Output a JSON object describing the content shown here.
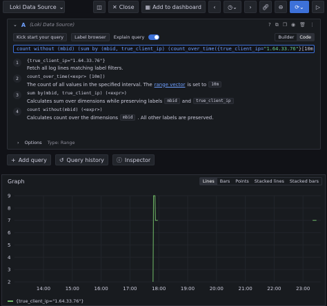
{
  "toolbar": {
    "datasource": "Loki Data Source",
    "close": "Close",
    "add_to_dashboard": "Add to dashboard"
  },
  "query": {
    "letter": "A",
    "datasource_label": "(Loki Data Source)",
    "kick_start": "Kick start your query",
    "label_browser": "Label browser",
    "explain_label": "Explain query",
    "builder": "Builder",
    "code": "Code",
    "expr_parts": {
      "p1": "count without (mbid) (sum by (mbid, true_client_ip) (count_over_time({true_client_ip=",
      "p2": "\"1.64.33.76\"",
      "p3": "}[10m])))"
    }
  },
  "explain": {
    "s1_code": "{true_client_ip=\"1.64.33.76\"}",
    "s1_desc": "Fetch all log lines matching label filters.",
    "s2_code": "count_over_time(<expr> [10m])",
    "s2_desc_a": "The count of all values in the specified interval. The",
    "s2_link": "range vector",
    "s2_desc_b": "is set to",
    "s2_chip": "10m",
    "s3_code": "sum by(mbid, true_client_ip) (<expr>)",
    "s3_desc_a": "Calculates sum over dimensions while preserving labels",
    "s3_chip1": "mbid",
    "s3_and": "and",
    "s3_chip2": "true_client_ip",
    "s4_code": "count without(mbid) (<expr>)",
    "s4_desc_a": "Calculates count over the dimensions",
    "s4_chip": "mbid",
    "s4_desc_b": ". All other labels are preserved."
  },
  "options": {
    "label": "Options",
    "type": "Type: Range"
  },
  "actions": {
    "add_query": "Add query",
    "query_history": "Query history",
    "inspector": "Inspector"
  },
  "graph": {
    "title": "Graph",
    "tabs": [
      "Lines",
      "Bars",
      "Points",
      "Stacked lines",
      "Stacked bars"
    ],
    "legend": "{true_client_ip=\"1.64.33.76\"}"
  },
  "chart_data": {
    "type": "line",
    "title": "Graph",
    "x_ticks": [
      "14:00",
      "15:00",
      "16:00",
      "17:00",
      "18:00",
      "19:00",
      "20:00",
      "21:00",
      "22:00",
      "23:00"
    ],
    "y_ticks": [
      2,
      3,
      4,
      5,
      6,
      7,
      8,
      9
    ],
    "ylim": [
      2,
      9
    ],
    "series": [
      {
        "name": "{true_client_ip=\"1.64.33.76\"}",
        "color": "#73bf69",
        "points": [
          {
            "x": "17:48",
            "y": 2
          },
          {
            "x": "17:49",
            "y": 9
          },
          {
            "x": "17:52",
            "y": 9
          },
          {
            "x": "17:53",
            "y": 7
          },
          {
            "x": "17:58",
            "y": 7
          },
          {
            "x": "23:20",
            "y": 7
          },
          {
            "x": "23:28",
            "y": 7
          }
        ]
      }
    ]
  }
}
